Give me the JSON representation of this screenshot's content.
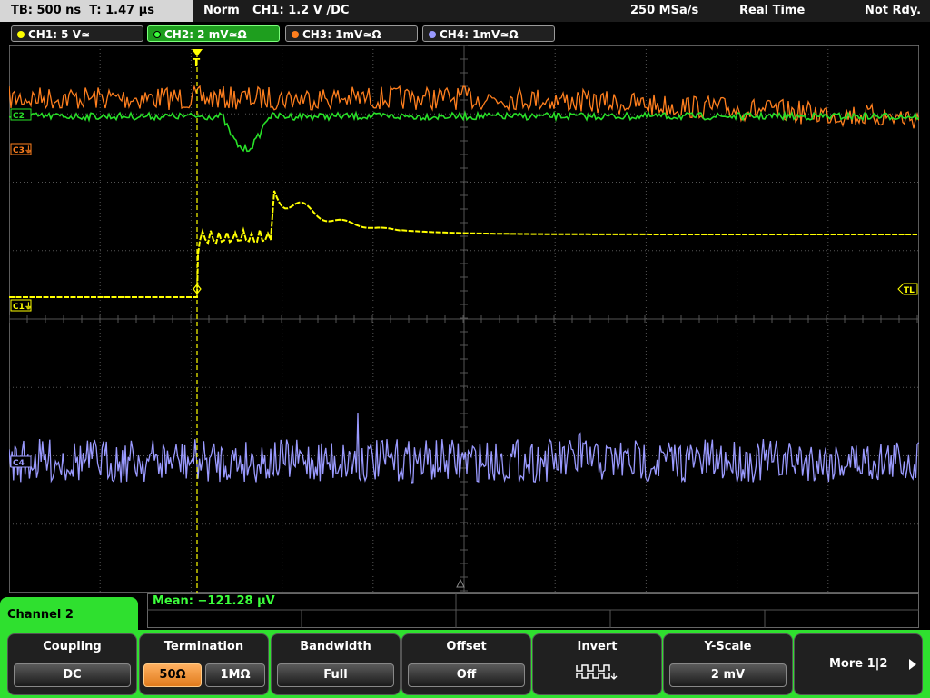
{
  "status": {
    "timebase": "TB: 500 ns",
    "trigger_time": "T: 1.47 µs",
    "mode": "Norm",
    "trigger": "CH1: 1.2 V ∕DC",
    "sample_rate": "250 MSa/s",
    "acq": "Real Time",
    "ready": "Not Rdy."
  },
  "channels": [
    {
      "label": "CH1: 5 V≃",
      "color": "#ffff00"
    },
    {
      "label": "CH2: 2 mV≃Ω",
      "color": "#3cff3c"
    },
    {
      "label": "CH3: 1mV≃Ω",
      "color": "#ff7f1e"
    },
    {
      "label": "CH4: 1mV≃Ω",
      "color": "#9a9aff"
    }
  ],
  "markers": {
    "c3": "C3⏚",
    "c1": "C1⏚",
    "tl": "TL",
    "c2": "C2",
    "c4": "C4"
  },
  "measurement": "Mean: −121.28 µV",
  "menu": {
    "title": "Channel 2",
    "coupling": {
      "label": "Coupling",
      "value": "DC"
    },
    "termination": {
      "label": "Termination",
      "opt1": "50Ω",
      "opt2": "1MΩ"
    },
    "bandwidth": {
      "label": "Bandwidth",
      "value": "Full"
    },
    "offset": {
      "label": "Offset",
      "value": "Off"
    },
    "invert": {
      "label": "Invert",
      "icon": "invert-waveform-icon"
    },
    "yscale": {
      "label": "Y-Scale",
      "value": "2 mV"
    },
    "more": {
      "label": "More 1|2",
      "icon": "play-arrow-icon"
    }
  }
}
